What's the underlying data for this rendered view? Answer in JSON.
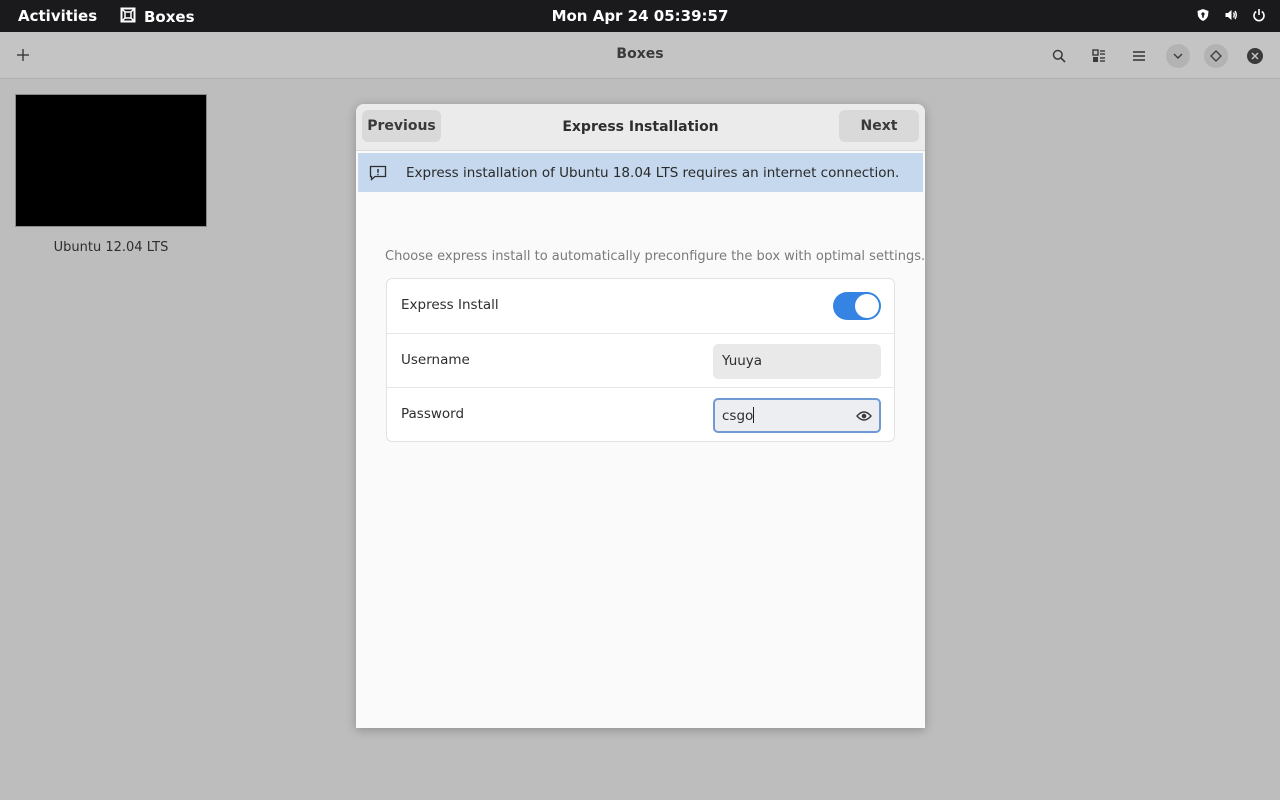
{
  "topbar": {
    "activities": "Activities",
    "app_name": "Boxes",
    "clock": "Mon Apr 24  05:39:57"
  },
  "headerbar": {
    "title": "Boxes"
  },
  "collection": {
    "items": [
      {
        "label": "Ubuntu 12.04 LTS"
      }
    ]
  },
  "dialog": {
    "title": "Express Installation",
    "previous_label": "Previous",
    "next_label": "Next",
    "info_message": "Express installation of Ubuntu 18.04 LTS requires an internet connection.",
    "description": "Choose express install to automatically preconfigure the box with optimal settings.",
    "express_install": {
      "label": "Express Install",
      "enabled": true
    },
    "username": {
      "label": "Username",
      "value": "Yuuya"
    },
    "password": {
      "label": "Password",
      "value": "csgo"
    }
  },
  "colors": {
    "accent": "#3584e4",
    "info_bar": "#c5d8ee",
    "topbar": "#1a1a1c"
  }
}
